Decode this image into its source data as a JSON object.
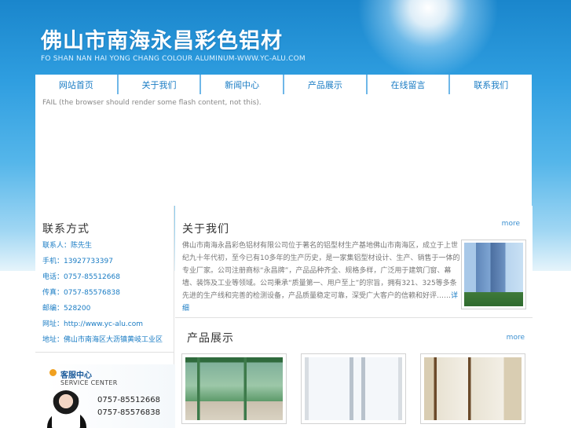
{
  "header": {
    "title": "佛山市南海永昌彩色铝材",
    "subtitle": "FO SHAN NAN HAI YONG CHANG COLOUR ALUMINUM-WWW.YC-ALU.COM"
  },
  "nav": {
    "items": [
      {
        "label": "网站首页"
      },
      {
        "label": "关于我们"
      },
      {
        "label": "新闻中心"
      },
      {
        "label": "产品展示"
      },
      {
        "label": "在线留言"
      },
      {
        "label": "联系我们"
      }
    ]
  },
  "flash": {
    "fallback": "FAIL (the browser should render some flash content, not this)."
  },
  "contact": {
    "heading": "联系方式",
    "lines": [
      "联系人：陈先生",
      "手机：13927733397",
      "电话：0757-85512668",
      "传真：0757-85576838",
      "邮编：528200",
      "网址：http://www.yc-alu.com",
      "地址：佛山市南海区大沥镇黄岐工业区"
    ]
  },
  "service": {
    "title": "客服中心",
    "subtitle": "SERVICE CENTER",
    "phone1": "0757-85512668",
    "phone2": "0757-85576838"
  },
  "about": {
    "heading": "关于我们",
    "more": "more",
    "text": "佛山市南海永昌彩色铝材有限公司位于著名的铝型材生产基地佛山市南海区，成立于上世纪九十年代初，至今已有10多年的生产历史，是一家集铝型材设计、生产、销售于一体的专业厂家。公司注册商标“永昌牌”，产品品种齐全、规格多样，广泛用于建筑门窗、幕墙、装饰及工业等领域。公司秉承“质量第一、用户至上”的宗旨，拥有321、325等多条先进的生产线和完善的检测设备，产品质量稳定可靠，深受广大客户的信赖和好评……",
    "read_more": "详 细"
  },
  "products": {
    "heading": "产品展示",
    "more": "more"
  }
}
